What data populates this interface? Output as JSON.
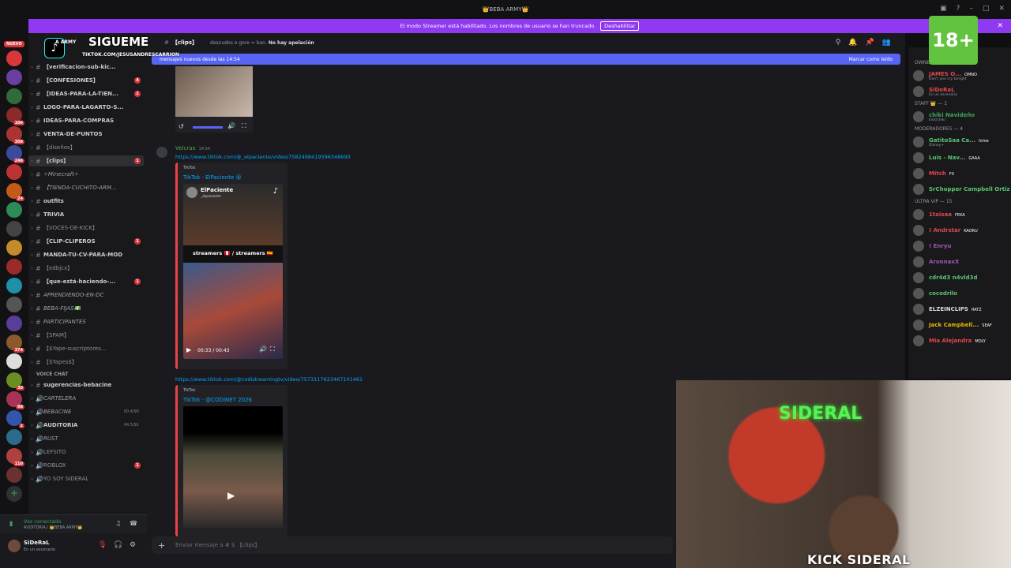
{
  "titlebar": {
    "title": "👑BEBA ARMY👑"
  },
  "banner": {
    "text": "El modo Streamer está habilitado. Los nombres de usuario se han truncado.",
    "disable": "Deshabilitar"
  },
  "server_rail": {
    "new_badge": "NUEVO",
    "badges": [
      "106",
      "308",
      "248",
      "24",
      "374",
      "30",
      "98",
      "2",
      "110"
    ]
  },
  "channels": [
    {
      "label": "【verificacion-sub-kic...",
      "style": "bold"
    },
    {
      "label": "【CONFESIONES】",
      "style": "bold",
      "badge": "4"
    },
    {
      "label": "【IDEAS-PARA-LA-TIEN...",
      "style": "bold",
      "badge": "1"
    },
    {
      "label": "LOGO-PARA-LAGARTO-S...",
      "style": "bold"
    },
    {
      "label": "IDEAS-PARA-COMPRAS",
      "style": "bold"
    },
    {
      "label": "VENTA-DE-PUNTOS",
      "style": "bold"
    },
    {
      "label": "【diseños】",
      "style": "dim"
    },
    {
      "label": "【clips】",
      "style": "active",
      "badge": "1"
    },
    {
      "label": "✧Minecraft✧",
      "style": "italic"
    },
    {
      "label": "【TIENDA-CUCHITO-ARM...",
      "style": "italic"
    },
    {
      "label": "outfits",
      "style": "bold"
    },
    {
      "label": "TRIVIA",
      "style": "bold"
    },
    {
      "label": "【VOCES-DE-KICK】",
      "style": "dim"
    },
    {
      "label": "【CLIP-CLIPEROS",
      "style": "bold",
      "badge": "1"
    },
    {
      "label": "MANDA-TU-CV-PARA-MOD",
      "style": "bold"
    },
    {
      "label": "【edbjcx】",
      "style": "dim"
    },
    {
      "label": "【que-está-haciendo-...",
      "style": "bold",
      "badge": "1"
    },
    {
      "label": "APRENDIENDO-EN-DC",
      "style": "italic"
    },
    {
      "label": "BEBA-FIJAS💵",
      "style": "italic"
    },
    {
      "label": "PARTICIPANTES",
      "style": "italic"
    },
    {
      "label": "【SPAM】",
      "style": "dim"
    },
    {
      "label": "【$Yape-suscriptores...",
      "style": "dim"
    },
    {
      "label": "【$Yapes$】",
      "style": "dim"
    }
  ],
  "voice": {
    "header": "VOICE CHAT",
    "items": [
      {
        "label": "sugerencias-bebacine",
        "style": "bold"
      },
      {
        "label": "CARTELERA",
        "style": "italic"
      },
      {
        "label": "BEBACINE",
        "style": "italic",
        "count": "00  4/90"
      },
      {
        "label": "AUDITORIA",
        "style": "bold",
        "count": "04  5/91"
      },
      {
        "label": "RUST",
        "style": "italic"
      },
      {
        "label": "LEFSITO",
        "style": "dim"
      },
      {
        "label": "ROBLOX",
        "style": "dim",
        "badge": "1"
      },
      {
        "label": "YO SOY SIDERAL",
        "style": "dim"
      }
    ]
  },
  "voice_connected": {
    "status": "Voz conectada",
    "channel": "AUDITORIA / 👑BEBA ARMY👑"
  },
  "user": {
    "name": "SiDeRaL",
    "status": "En un escenario"
  },
  "channel_header": {
    "name": "【clips】",
    "topic_prefix": "desnudos o gore = ban.",
    "topic_bold": "No hay apelación"
  },
  "new_messages": {
    "text": "mensajes nuevos desde las 14:54",
    "mark_read": "Marcar como leído"
  },
  "messages": [
    {
      "author": "Velcrax",
      "time": "14:54",
      "link1": "https://www.tiktok.com/@_elpaciente/video/7582498419596348690",
      "embed1": {
        "provider": "TikTok",
        "title": "TikTok · ElPaciente 😝",
        "channel": "ElPaciente",
        "handle": "_elpaciente",
        "caption": "streamers 🇵🇪 / streamers 🇪🇸",
        "time": "00:33 / 00:43"
      },
      "link2": "https://www.tiktok.com/@codistreamingtv/video/7573117623467101461",
      "embed2": {
        "provider": "TikTok",
        "title": "TikTok · @CODINET 2026"
      }
    }
  ],
  "input": {
    "placeholder": "Enviar mensaje a # $ 【clips】"
  },
  "members": {
    "sections": [
      {
        "title": "OWNER"
      },
      {
        "title": "STAFF 👑 — 1"
      },
      {
        "title": "MODERADORES — 4"
      },
      {
        "title": "ULTRA VIP — 15"
      }
    ],
    "items": [
      {
        "name": "JAMES O...",
        "tag": "OMNO",
        "sub": "Don't you cry tonight",
        "color": "#e0484c"
      },
      {
        "name": "SiDeRaL",
        "tag": "",
        "sub": "En un escenario",
        "color": "#e0484c"
      },
      {
        "name": "chiki Navideño",
        "tag": "",
        "sub": "kick/chiki",
        "color": "#3ba55c"
      },
      {
        "name": "GatitoSaa Ca...",
        "tag": "hime",
        "sub": "Disney+",
        "color": "#5ac36e"
      },
      {
        "name": "Luis - Nav...",
        "tag": "GAAA",
        "sub": "",
        "color": "#5ac36e"
      },
      {
        "name": "Mitch",
        "tag": "F0",
        "sub": "",
        "color": "#e0484c"
      },
      {
        "name": "SrChopper Campbell Ortiz",
        "tag": "",
        "sub": "",
        "color": "#5ac36e"
      },
      {
        "name": "1taisaa",
        "tag": "FEKA",
        "sub": "",
        "color": "#e0484c"
      },
      {
        "name": "! Andrstar",
        "tag": "KAORU",
        "sub": "",
        "color": "#e0484c"
      },
      {
        "name": "! Enryu",
        "tag": "",
        "sub": "",
        "color": "#9b59b6"
      },
      {
        "name": "AronnaxX",
        "tag": "",
        "sub": "",
        "color": "#9b59b6"
      },
      {
        "name": "cdr4d3 n4vld3d",
        "tag": "",
        "sub": "",
        "color": "#5ac36e"
      },
      {
        "name": "cocodrilo",
        "tag": "",
        "sub": "",
        "color": "#5ac36e"
      },
      {
        "name": "ELZEINCLIPS",
        "tag": "RATZ",
        "sub": "",
        "color": "#dbdee1"
      },
      {
        "name": "Jack Campbell...",
        "tag": "SEAF",
        "sub": "",
        "color": "#e6b800"
      },
      {
        "name": "Mia Alejandra",
        "tag": "MOLY",
        "sub": "",
        "color": "#e0484c"
      }
    ]
  },
  "overlay": {
    "follow": "SIGUEME",
    "tiktok_handle": "TIKTOK.COM/JESUSANDRESCARRION",
    "beba_army": "A ARMY",
    "age_label": "18+"
  },
  "webcam": {
    "sign": "SIDERAL",
    "kick_label": "KICK SIDERAL"
  },
  "colors": {
    "accent": "#5865f2",
    "banner": "#8f39f1",
    "embed_border": "#ed4245",
    "kick_green": "#53fc18"
  }
}
